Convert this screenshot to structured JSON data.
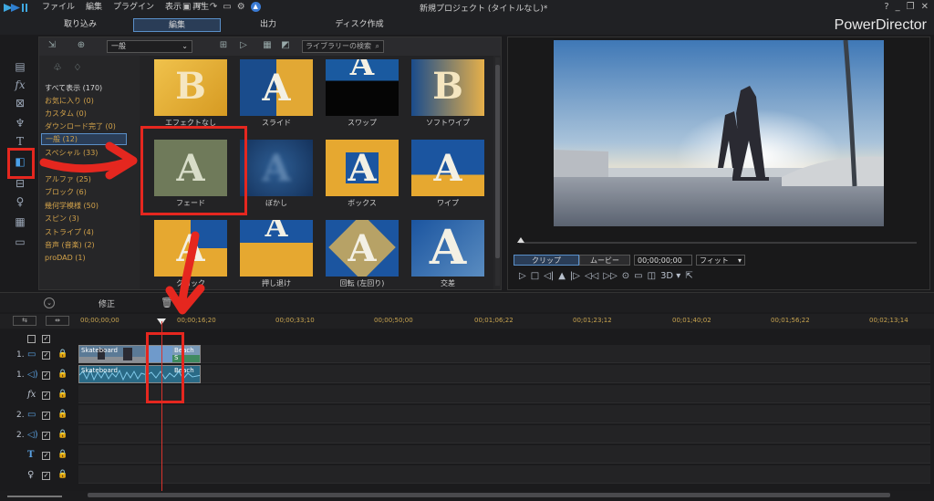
{
  "menu": [
    "ファイル",
    "編集",
    "プラグイン",
    "表示",
    "再生"
  ],
  "project_title": "新規プロジェクト (タイトルなし)*",
  "window_controls": [
    "?",
    "_",
    "❐",
    "✕"
  ],
  "modes": [
    {
      "label": "取り込み",
      "active": false
    },
    {
      "label": "編集",
      "active": true
    },
    {
      "label": "出力",
      "active": false
    },
    {
      "label": "ディスク作成",
      "active": false
    }
  ],
  "brand": "PowerDirector",
  "library": {
    "dropdown": "一般",
    "search_placeholder": "ライブラリーの検索",
    "categories": [
      "すべて表示 (170)",
      "お気に入り (0)",
      "カスタム (0)",
      "ダウンロード完了 (0)",
      "一般 (12)",
      "スペシャル (33)",
      "3D",
      "アルファ (25)",
      "ブロック (6)",
      "幾何学模様 (50)",
      "スピン (3)",
      "ストライプ (4)",
      "音声 (音楽) (2)",
      "proDAD (1)"
    ],
    "selected_category": "一般 (12)",
    "thumbnails": [
      {
        "label": "エフェクトなし",
        "glyph": "B"
      },
      {
        "label": "スライド",
        "glyph": "A"
      },
      {
        "label": "スワップ",
        "glyph": "A"
      },
      {
        "label": "ソフトワイプ",
        "glyph": "B"
      },
      {
        "label": "フェード",
        "glyph": "A"
      },
      {
        "label": "ぼかし",
        "glyph": "A"
      },
      {
        "label": "ボックス",
        "glyph": "A"
      },
      {
        "label": "ワイプ",
        "glyph": "A"
      },
      {
        "label": "クロック",
        "glyph": "A"
      },
      {
        "label": "押し退け",
        "glyph": "A"
      },
      {
        "label": "回転 (左回り)",
        "glyph": "A"
      },
      {
        "label": "交差",
        "glyph": "A"
      }
    ]
  },
  "preview": {
    "tab_clip": "クリップ",
    "tab_movie": "ムービー",
    "timecode": "00;00;00;00",
    "fit": "フィット",
    "controls": [
      "▷",
      "□",
      "◁|",
      "▲",
      "|▷",
      "◁◁",
      "▷▷",
      "⊙",
      "▭",
      "◫",
      "3D ▾",
      "⇱"
    ]
  },
  "timeline": {
    "fix_label": "修正",
    "ticks": [
      "00;00;00;00",
      "00;00;16;20",
      "00;00;33;10",
      "00;00;50;00",
      "00;01;06;22",
      "00;01;23;12",
      "00;01;40;02",
      "00;01;56;22",
      "00;02;13;14"
    ],
    "tracks": [
      {
        "num": "1.",
        "icon": "▭",
        "kind": "video"
      },
      {
        "num": "1.",
        "icon": "◁)",
        "kind": "audio"
      },
      {
        "num": "",
        "icon": "fx",
        "kind": "fx"
      },
      {
        "num": "2.",
        "icon": "▭",
        "kind": "video"
      },
      {
        "num": "2.",
        "icon": "◁)",
        "kind": "audio"
      },
      {
        "num": "",
        "icon": "T",
        "kind": "title"
      },
      {
        "num": "",
        "icon": "♀",
        "kind": "voice"
      }
    ],
    "clips": {
      "video1a": "Skateboard",
      "video1b": "Beach S",
      "audio1a": "Skateboard",
      "audio1b": "Beach"
    }
  },
  "colors": {
    "annotation": "#e5271f",
    "accent": "#5a8fc8",
    "category_text": "#d2a24a"
  }
}
